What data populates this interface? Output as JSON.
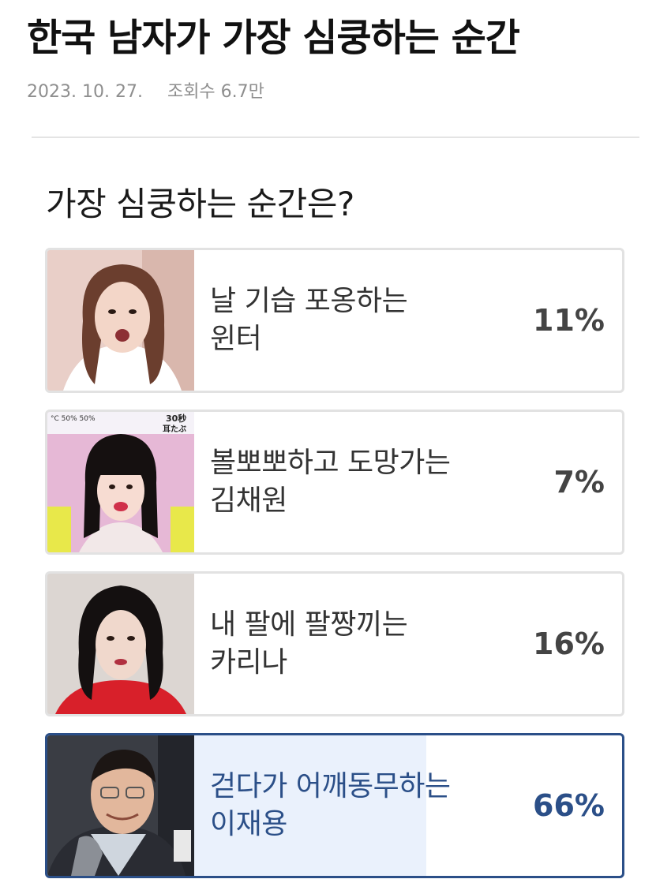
{
  "article": {
    "title": "한국 남자가 가장 심쿵하는 순간",
    "date": "2023. 10. 27.",
    "views": "조회수 6.7만"
  },
  "poll": {
    "question": "가장 심쿵하는 순간은?",
    "accent_color": "#2b4f88",
    "options": [
      {
        "label": "날 기습 포옹하는\n윈터",
        "percent": "11%",
        "value": 11,
        "selected": false,
        "photo": "photo-winter"
      },
      {
        "label": "볼뽀뽀하고 도망가는\n김채원",
        "percent": "7%",
        "value": 7,
        "selected": false,
        "photo": "photo-kim-chaewon",
        "photo_overlay": [
          "30秒",
          "耳たぶ",
          "°C 50% 50%"
        ]
      },
      {
        "label": "내 팔에 팔짱끼는\n카리나",
        "percent": "16%",
        "value": 16,
        "selected": false,
        "photo": "photo-karina"
      },
      {
        "label": "걷다가 어깨동무하는\n이재용",
        "percent": "66%",
        "value": 66,
        "selected": true,
        "photo": "photo-lee-jaeyong"
      }
    ]
  }
}
